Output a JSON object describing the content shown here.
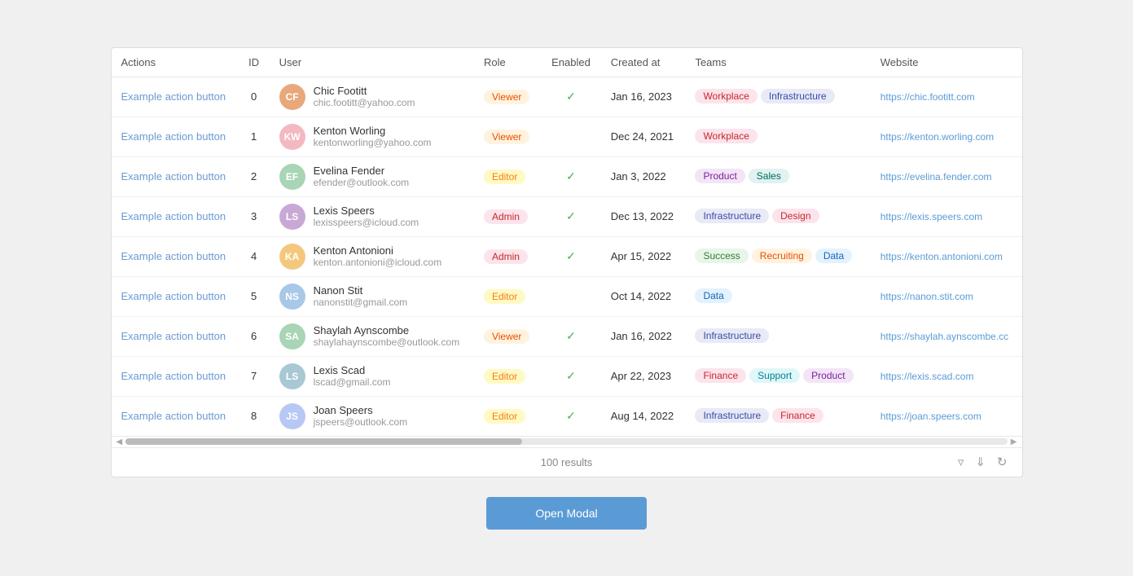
{
  "table": {
    "columns": [
      "Actions",
      "ID",
      "User",
      "Role",
      "Enabled",
      "Created at",
      "Teams",
      "Website"
    ],
    "rows": [
      {
        "id": 0,
        "initials": "CF",
        "avatarColor": "#e8a87c",
        "name": "Chic Footitt",
        "email": "chic.footitt@yahoo.com",
        "role": "Viewer",
        "roleClass": "role-viewer",
        "enabled": true,
        "createdAt": "Jan 16, 2023",
        "teams": [
          {
            "label": "Workplace",
            "class": "team-workplace"
          },
          {
            "label": "Infrastructure",
            "class": "team-infrastructure"
          }
        ],
        "website": "https://chic.footitt.com",
        "websiteShort": "https://chic.footitt.com"
      },
      {
        "id": 1,
        "initials": "KW",
        "avatarColor": "#f4b8c1",
        "name": "Kenton Worling",
        "email": "kentonworling@yahoo.com",
        "role": "Viewer",
        "roleClass": "role-viewer",
        "enabled": false,
        "createdAt": "Dec 24, 2021",
        "teams": [
          {
            "label": "Workplace",
            "class": "team-workplace"
          }
        ],
        "website": "https://kenton.worling.com",
        "websiteShort": "https://kenton.worling.com"
      },
      {
        "id": 2,
        "initials": "EF",
        "avatarColor": "#a8d5b5",
        "name": "Evelina Fender",
        "email": "efender@outlook.com",
        "role": "Editor",
        "roleClass": "role-editor",
        "enabled": true,
        "createdAt": "Jan 3, 2022",
        "teams": [
          {
            "label": "Product",
            "class": "team-product"
          },
          {
            "label": "Sales",
            "class": "team-sales"
          }
        ],
        "website": "https://evelina.fender.com",
        "websiteShort": "https://evelina.fender.com"
      },
      {
        "id": 3,
        "initials": "LS",
        "avatarColor": "#c9a8d5",
        "name": "Lexis Speers",
        "email": "lexisspeers@icloud.com",
        "role": "Admin",
        "roleClass": "role-admin",
        "enabled": true,
        "createdAt": "Dec 13, 2022",
        "teams": [
          {
            "label": "Infrastructure",
            "class": "team-infrastructure"
          },
          {
            "label": "Design",
            "class": "team-design"
          }
        ],
        "website": "https://lexis.speers.com",
        "websiteShort": "https://lexis.speers.com"
      },
      {
        "id": 4,
        "initials": "KA",
        "avatarColor": "#f4c87c",
        "name": "Kenton Antonioni",
        "email": "kenton.antonioni@icloud.com",
        "role": "Admin",
        "roleClass": "role-admin",
        "enabled": true,
        "createdAt": "Apr 15, 2022",
        "teams": [
          {
            "label": "Success",
            "class": "team-success"
          },
          {
            "label": "Recruiting",
            "class": "team-recruiting"
          },
          {
            "label": "Data",
            "class": "team-data"
          }
        ],
        "website": "https://kenton.antonioni.com",
        "websiteShort": "https://kenton.antonioni.com"
      },
      {
        "id": 5,
        "initials": "NS",
        "avatarColor": "#a8c8e8",
        "name": "Nanon Stit",
        "email": "nanonstit@gmail.com",
        "role": "Editor",
        "roleClass": "role-editor",
        "enabled": false,
        "createdAt": "Oct 14, 2022",
        "teams": [
          {
            "label": "Data",
            "class": "team-data"
          }
        ],
        "website": "https://nanon.stit.com",
        "websiteShort": "https://nanon.stit.com"
      },
      {
        "id": 6,
        "initials": "SA",
        "avatarColor": "#a8d5b5",
        "name": "Shaylah Aynscombe",
        "email": "shaylahaynscombe@outlook.com",
        "role": "Viewer",
        "roleClass": "role-viewer",
        "enabled": true,
        "createdAt": "Jan 16, 2022",
        "teams": [
          {
            "label": "Infrastructure",
            "class": "team-infrastructure"
          }
        ],
        "website": "https://shaylah.aynscombe.co",
        "websiteShort": "https://shaylah.aynscombe.cc"
      },
      {
        "id": 7,
        "initials": "LS",
        "avatarColor": "#a8c8d5",
        "name": "Lexis Scad",
        "email": "lscad@gmail.com",
        "role": "Editor",
        "roleClass": "role-editor",
        "enabled": true,
        "createdAt": "Apr 22, 2023",
        "teams": [
          {
            "label": "Finance",
            "class": "team-finance"
          },
          {
            "label": "Support",
            "class": "team-support"
          },
          {
            "label": "Product",
            "class": "team-product"
          }
        ],
        "website": "https://lexis.scad.com",
        "websiteShort": "https://lexis.scad.com"
      },
      {
        "id": 8,
        "initials": "JS",
        "avatarColor": "#b8c8f4",
        "name": "Joan Speers",
        "email": "jspeers@outlook.com",
        "role": "Editor",
        "roleClass": "role-editor",
        "enabled": true,
        "createdAt": "Aug 14, 2022",
        "teams": [
          {
            "label": "Infrastructure",
            "class": "team-infrastructure"
          },
          {
            "label": "Finance",
            "class": "team-finance"
          }
        ],
        "website": "https://joan.speers.com",
        "websiteShort": "https://joan.speers.com"
      }
    ],
    "resultsCount": "100 results",
    "actionLabel": "Example action button",
    "openModalLabel": "Open Modal"
  }
}
